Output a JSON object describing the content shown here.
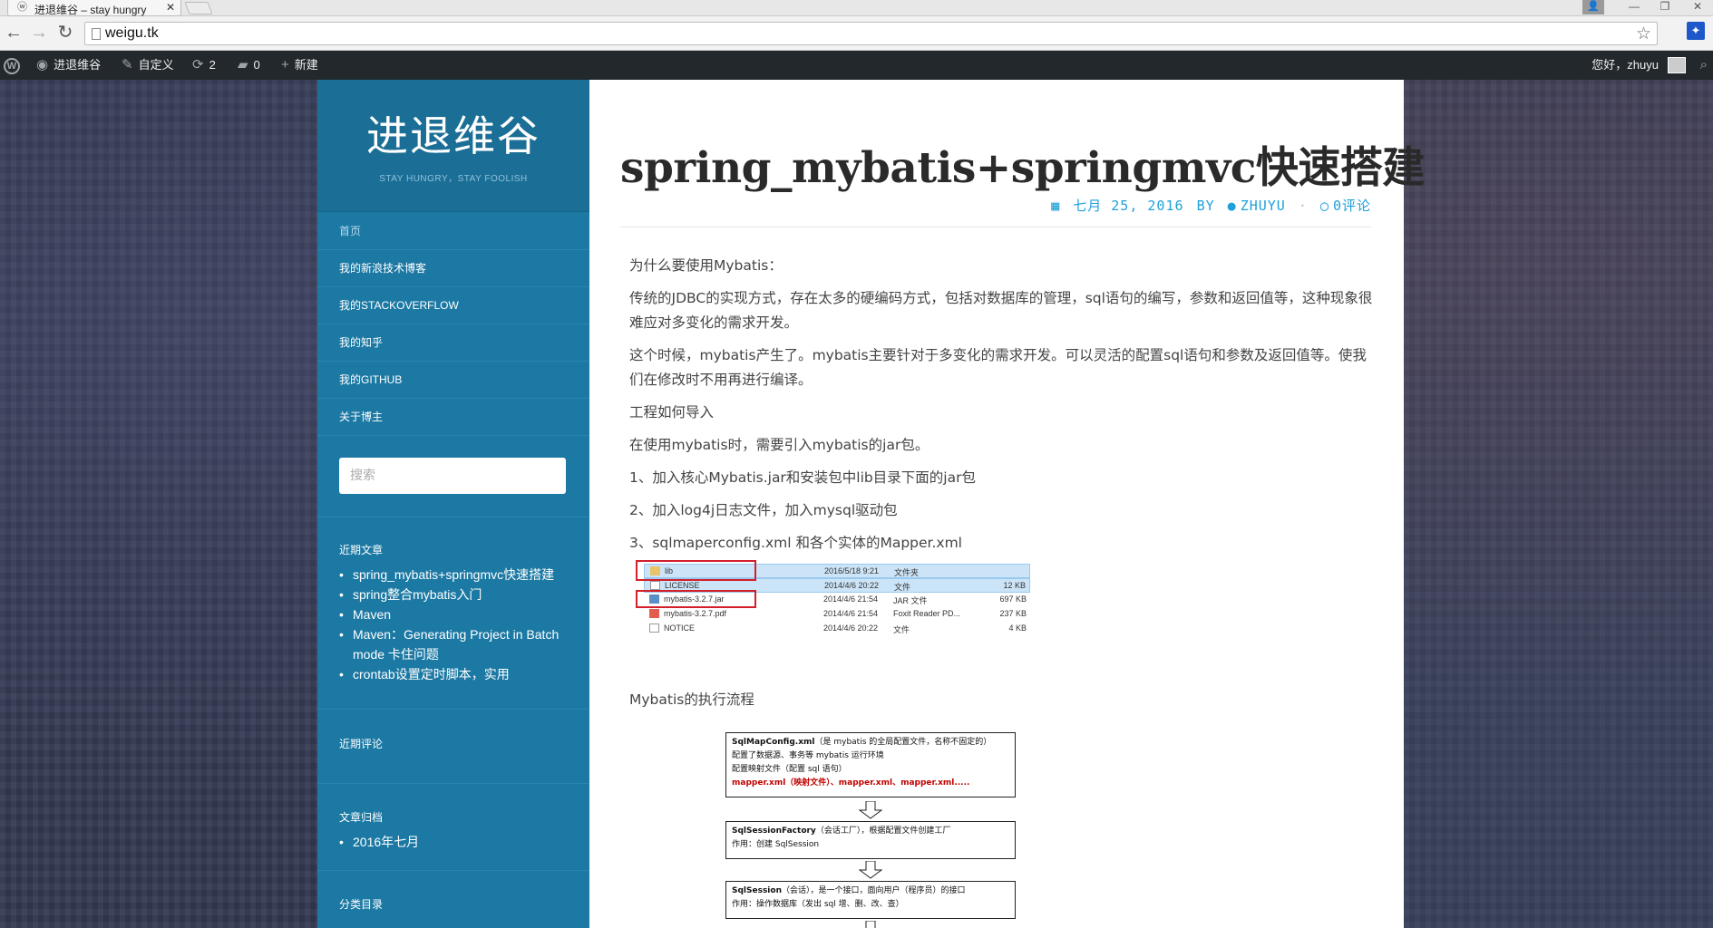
{
  "browser": {
    "tab_title": "进退维谷 – stay hungry",
    "tab_favicon": "wordpress-favicon",
    "tab_close": "✕",
    "url": "weigu.tk",
    "back_glyph": "←",
    "forward_glyph": "→",
    "reload_glyph": "↻",
    "star_glyph": "☆",
    "ext_glyph": "🐾",
    "window_controls": [
      "—",
      "❐",
      "✕"
    ]
  },
  "admin_bar": {
    "site_name": "进退维谷",
    "customize": "自定义",
    "updates_count": "2",
    "comments_count": "0",
    "new_label": "新建",
    "greeting": "您好，zhuyu",
    "icons": {
      "site": "dashboard-icon",
      "customize": "brush-icon",
      "updates": "updates-icon",
      "comments": "comment-icon",
      "new": "plus-icon",
      "search": "search-icon"
    }
  },
  "sidebar": {
    "site_title": "进退维谷",
    "site_description": "STAY HUNGRY，STAY FOOLISH",
    "menu": [
      {
        "label": "首页"
      },
      {
        "label": "我的新浪技术博客"
      },
      {
        "label": "我的STACKOVERFLOW"
      },
      {
        "label": "我的知乎"
      },
      {
        "label": "我的GITHUB"
      },
      {
        "label": "关于博主"
      }
    ],
    "search_placeholder": "搜索",
    "recent_posts_title": "近期文章",
    "recent_posts": [
      "spring_mybatis+springmvc快速搭建",
      "spring整合mybatis入门",
      "Maven",
      "Maven：Generating Project in Batch mode 卡住问题",
      "crontab设置定时脚本，实用"
    ],
    "recent_comments_title": "近期评论",
    "archives_title": "文章归档",
    "archives": [
      "2016年七月"
    ],
    "categories_title": "分类目录"
  },
  "post": {
    "title": "spring_mybatis+springmvc快速搭建",
    "date": "七月 25, 2016",
    "by": "BY",
    "author": "ZHUYU",
    "comments": "0评论",
    "paragraphs": [
      "为什么要使用Mybatis：",
      "传统的JDBC的实现方式，存在太多的硬编码方式，包括对数据库的管理，sql语句的编写，参数和返回值等，这种现象很难应对多变化的需求开发。",
      "这个时候，mybatis产生了。mybatis主要针对于多变化的需求开发。可以灵活的配置sql语句和参数及返回值等。使我们在修改时不用再进行编译。",
      "工程如何导入",
      "在使用mybatis时，需要引入mybatis的jar包。",
      "1、加入核心Mybatis.jar和安装包中lib目录下面的jar包",
      "2、加入log4j日志文件，加入mysql驱动包",
      "3、sqlmaperconfig.xml 和各个实体的Mapper.xml"
    ],
    "file_listing": [
      {
        "name": "lib",
        "date": "2016/5/18 9:21",
        "type": "文件夹",
        "size": ""
      },
      {
        "name": "LICENSE",
        "date": "2014/4/6 20:22",
        "type": "文件",
        "size": "12 KB"
      },
      {
        "name": "mybatis-3.2.7.jar",
        "date": "2014/4/6 21:54",
        "type": "JAR 文件",
        "size": "697 KB"
      },
      {
        "name": "mybatis-3.2.7.pdf",
        "date": "2014/4/6 21:54",
        "type": "Foxit Reader PD...",
        "size": "237 KB"
      },
      {
        "name": "NOTICE",
        "date": "2014/4/6 20:22",
        "type": "文件",
        "size": "4 KB"
      }
    ],
    "flow_heading": "Mybatis的执行流程",
    "flow_boxes": [
      {
        "line1_bold": "SqlMapConfig.xml",
        "line1_rest": "（是 mybatis 的全局配置文件，名称不固定的）",
        "line2": "配置了数据源、事务等 mybatis 运行环境",
        "line3": "配置映射文件（配置 sql 语句）",
        "line4_red": "mapper.xml（映射文件）、mapper.xml、mapper.xml....."
      },
      {
        "line1_bold": "SqlSessionFactory",
        "line1_rest": "（会话工厂），根据配置文件创建工厂",
        "line2": "作用：创建 SqlSession"
      },
      {
        "line1_bold": "SqlSession",
        "line1_rest": "（会话），是一个接口，面向用户（程序员）的接口",
        "line2": "作用：操作数据库（发出 sql 增、删、改、查）"
      }
    ]
  }
}
